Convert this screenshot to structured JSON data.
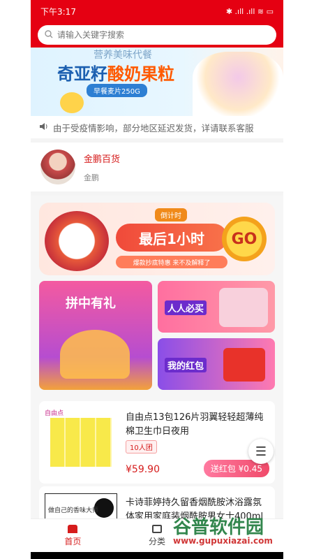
{
  "status": {
    "time": "下午3:17",
    "icons": "✱ .ıll .ıll ≋ ▭"
  },
  "search": {
    "placeholder": "请输入关键字搜索"
  },
  "banner": {
    "subtitle": "营养美味代餐",
    "title_part1": "奇亚籽",
    "title_part2": "酸奶果粒",
    "pill": "早餐麦片250G"
  },
  "notice": {
    "text": "由于受疫情影响，部分地区延迟发货，详请联系客服"
  },
  "shop": {
    "name": "金鹏百货",
    "owner": "金鹏"
  },
  "promo": {
    "deadline": "倒计时",
    "headline": "最后1小时",
    "desc": "爆款抄底特惠 来不及解释了",
    "go": "GO"
  },
  "tiles": {
    "big": "拼中有礼",
    "a": "人人必买",
    "b": "我的红包"
  },
  "products": [
    {
      "brand": "自由点",
      "title": "自由点13包126片羽翼轻轻超薄纯棉卫生巾日夜用",
      "tag": "10人团",
      "price": "¥59.90",
      "redpack": "送红包 ¥0.45"
    },
    {
      "img_text": "做自己的香味大师",
      "title": "卡诗菲婷持久留香烟酰胺沐浴露氛体家用家庭装烟酰胺男女士400ml"
    }
  ],
  "tabs": [
    {
      "label": "首页"
    },
    {
      "label": "分类"
    }
  ],
  "watermark": {
    "main": "谷普软件园",
    "sub": "www.gupuxiazai.com"
  },
  "colors": {
    "primary": "#e50012",
    "accent": "#d61c1c"
  }
}
